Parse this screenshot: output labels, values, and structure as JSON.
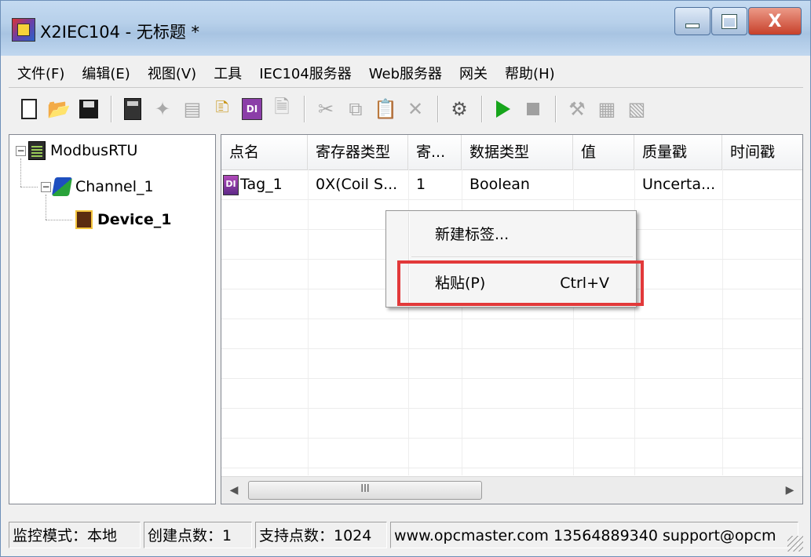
{
  "window": {
    "title": "X2IEC104 - 无标题 *",
    "close_glyph": "X"
  },
  "menubar": {
    "items": [
      "文件(F)",
      "编辑(E)",
      "视图(V)",
      "工具",
      "IEC104服务器",
      "Web服务器",
      "网关",
      "帮助(H)"
    ]
  },
  "toolbar": {
    "buttons": [
      {
        "icon": "new-file-icon",
        "enabled": true
      },
      {
        "icon": "open-folder-icon",
        "enabled": true
      },
      {
        "icon": "save-icon",
        "enabled": true
      },
      {
        "icon": "new-device-icon",
        "enabled": true
      },
      {
        "icon": "new-channel-icon",
        "enabled": false
      },
      {
        "icon": "device-icon",
        "enabled": false
      },
      {
        "icon": "new-tag-icon",
        "enabled": true
      },
      {
        "icon": "new-db-tag-icon",
        "enabled": true
      },
      {
        "icon": "properties-icon",
        "enabled": false
      },
      {
        "icon": "cut-icon",
        "enabled": false
      },
      {
        "icon": "copy-icon",
        "enabled": false
      },
      {
        "icon": "paste-icon",
        "enabled": true
      },
      {
        "icon": "delete-icon",
        "enabled": false
      },
      {
        "icon": "tools-icon",
        "enabled": true
      },
      {
        "icon": "start-icon",
        "enabled": true
      },
      {
        "icon": "stop-icon",
        "enabled": false
      },
      {
        "icon": "wrench-icon",
        "enabled": false
      },
      {
        "icon": "load-icon",
        "enabled": false
      },
      {
        "icon": "up-icon",
        "enabled": false
      }
    ]
  },
  "tree": {
    "root": "ModbusRTU",
    "channel": "Channel_1",
    "device": "Device_1"
  },
  "list": {
    "columns": [
      "点名",
      "寄存器类型",
      "寄...",
      "数据类型",
      "值",
      "质量戳",
      "时间戳"
    ],
    "rows": [
      {
        "name": "Tag_1",
        "register_type": "0X(Coil S...",
        "register": "1",
        "data_type": "Boolean",
        "value": "",
        "quality": "Uncerta...",
        "timestamp": ""
      }
    ],
    "tag_icon_text": "DI",
    "scroll_thumb_grip": "III"
  },
  "context_menu": {
    "new_tag": "新建标签...",
    "paste": "粘贴(P)",
    "paste_shortcut": "Ctrl+V",
    "highlight_color": "#e2393a"
  },
  "statusbar": {
    "mode": "监控模式：本地",
    "created": "创建点数：1",
    "supported": "支持点数：1024",
    "contact": "www.opcmaster.com 13564889340 support@opcm"
  }
}
